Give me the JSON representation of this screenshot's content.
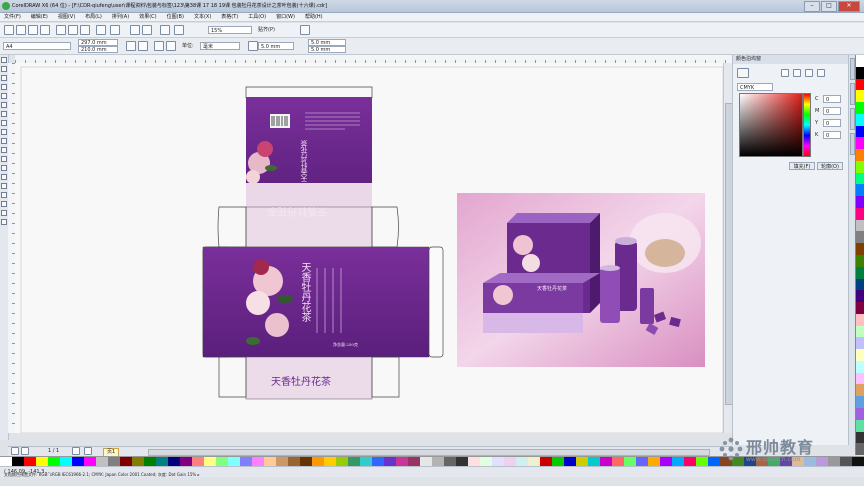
{
  "app": {
    "title": "CorelDRAW X6 (64 位) - [F:\\CDR-qiufeng\\user\\课程资料\\包装与标签\\123\\第38课 17 18 19课 包装牡丹花茶设计之茶叶包装(十六课).cdr]"
  },
  "window_buttons": {
    "minimize": "–",
    "maximize": "□",
    "close": "✕"
  },
  "menu": [
    "文件(F)",
    "编辑(E)",
    "视图(V)",
    "布局(L)",
    "排列(A)",
    "效果(C)",
    "位图(B)",
    "文本(X)",
    "表格(T)",
    "工具(O)",
    "窗口(W)",
    "帮助(H)"
  ],
  "toolbar": {
    "zoom": "15%",
    "snap": "贴齐(P)"
  },
  "propertybar": {
    "paper": "A4",
    "width": "297.0 mm",
    "height": "210.0 mm",
    "units_label": "单位:",
    "units": "毫米",
    "nudge": "5.0 mm",
    "dup_x": "5.0 mm",
    "dup_y": "5.0 mm"
  },
  "bottombar": {
    "page_count": "1 / 1",
    "page_tab": "页1"
  },
  "statusbar": {
    "coords": "( 146.09, -141.3 ...",
    "color_info": "文档颜色预置文件: RGB: sRGB IEC61966-2.1; CMYK: Japan Color 2001 Coated; 灰度: Dot Gain 15% ▸"
  },
  "docker": {
    "title": "颜色泊坞窗",
    "model": "CMYK",
    "channels": [
      {
        "label": "C",
        "value": "0"
      },
      {
        "label": "M",
        "value": "0"
      },
      {
        "label": "Y",
        "value": "0"
      },
      {
        "label": "K",
        "value": "0"
      }
    ],
    "fill_button": "填充(F)",
    "outline_button": "轮廓(O)"
  },
  "package": {
    "brand_name": "天香牡丹花茶",
    "side_brand": "天香牡丹花茶",
    "back_brand": "天香牡丹花茶",
    "net_weight": "净含量:250克"
  },
  "watermark": {
    "name": "邢帅教育",
    "url": "www.xsteach.com"
  },
  "colors": {
    "purple": "#6a2a8e",
    "pale_pink": "#ecd9ea",
    "accent": "#3aa845"
  }
}
